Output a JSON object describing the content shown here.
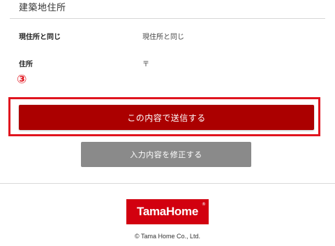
{
  "section": {
    "title": "建築地住所"
  },
  "rows": [
    {
      "label": "現住所と同じ",
      "value": "現住所と同じ"
    },
    {
      "label": "住所",
      "value": "〒"
    }
  ],
  "annotation": {
    "marker": "③",
    "highlight_color": "#e0141e"
  },
  "buttons": {
    "submit_label": "この内容で送信する",
    "edit_label": "入力内容を修正する"
  },
  "footer": {
    "logo_text": "TamaHome",
    "logo_mark": "®",
    "copyright": "© Tama Home Co., Ltd."
  },
  "colors": {
    "submit": "#ab0000",
    "edit": "#8a8a8a",
    "brand": "#d2000f"
  }
}
